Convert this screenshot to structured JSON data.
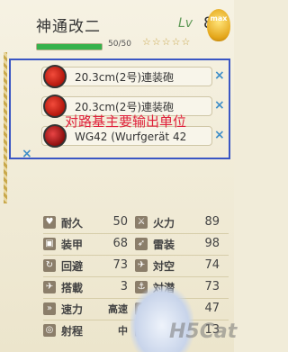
{
  "ship": {
    "name": "神通改二",
    "level_label": "Lv",
    "level": "83",
    "hp_text": "50/50",
    "hp_fraction": 1.0,
    "stars": "☆☆☆☆☆",
    "badge": "max"
  },
  "equipment": {
    "slots": [
      {
        "name": "20.3cm(2号)連装砲",
        "icon": "red-gun-icon"
      },
      {
        "name": "20.3cm(2号)連装砲",
        "icon": "red-gun-icon"
      },
      {
        "name": "WG42 (Wurfgerät 42",
        "icon": "rocket-launcher-icon"
      }
    ],
    "annotation": "对路基主要输出单位",
    "remove_symbol": "×"
  },
  "stats": [
    {
      "label": "耐久",
      "value": "50",
      "icon": "heart-icon"
    },
    {
      "label": "火力",
      "value": "89",
      "icon": "gun-icon"
    },
    {
      "label": "装甲",
      "value": "68",
      "icon": "armor-icon"
    },
    {
      "label": "雷装",
      "value": "98",
      "icon": "torpedo-icon"
    },
    {
      "label": "回避",
      "value": "73",
      "icon": "evasion-icon"
    },
    {
      "label": "対空",
      "value": "74",
      "icon": "antiair-icon"
    },
    {
      "label": "搭載",
      "value": "3",
      "icon": "plane-icon"
    },
    {
      "label": "対潜",
      "value": "73",
      "icon": "asw-icon"
    },
    {
      "label": "速力",
      "value": "高速",
      "icon": "speed-icon"
    },
    {
      "label": "索敵",
      "value": "47",
      "icon": "search-icon"
    },
    {
      "label": "射程",
      "value": "中",
      "icon": "range-icon"
    },
    {
      "label": "運",
      "value": "13",
      "icon": "luck-icon"
    }
  ],
  "watermark": "H5Cat"
}
